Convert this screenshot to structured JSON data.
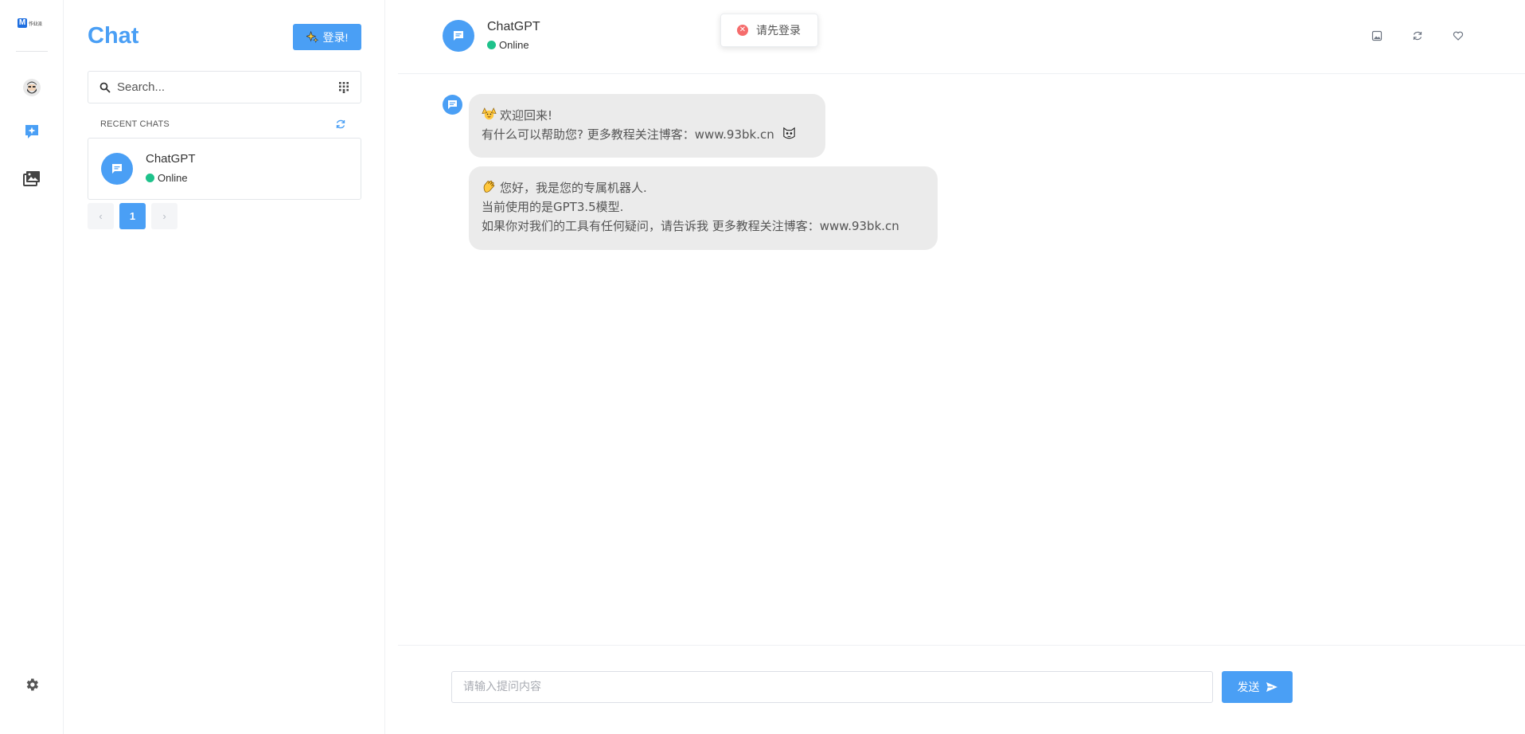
{
  "rail": {
    "logo_text": "作业派",
    "items": [
      {
        "name": "user-avatar",
        "icon": "bearded-man-avatar"
      },
      {
        "name": "chat",
        "icon": "chat-sparkle-icon"
      },
      {
        "name": "gallery",
        "icon": "images-icon"
      },
      {
        "name": "settings",
        "icon": "gear-icon"
      }
    ]
  },
  "panel": {
    "title": "Chat",
    "login_label": "登录!",
    "search_placeholder": "Search...",
    "recent_label": "RECENT CHATS",
    "chats": [
      {
        "name": "ChatGPT",
        "status": "Online"
      }
    ],
    "pager": {
      "current": "1",
      "prev": "‹",
      "next": "›"
    }
  },
  "header": {
    "name": "ChatGPT",
    "status": "Online"
  },
  "toast": {
    "text": "请先登录",
    "icon": "error-circle-icon"
  },
  "messages": [
    {
      "lines": [
        "欢迎回来!",
        "有什么可以帮助您? 更多教程关注博客：www.93bk.cn"
      ]
    },
    {
      "lines": [
        "您好，我是您的专属机器人.",
        "当前使用的是GPT3.5模型.",
        "如果你对我们的工具有任何疑问，请告诉我 更多教程关注博客：www.93bk.cn"
      ]
    }
  ],
  "composer": {
    "placeholder": "请输入提问内容",
    "send_label": "发送"
  },
  "colors": {
    "accent": "#4a9ff5",
    "online": "#1ec28b",
    "bubble": "#ebebeb",
    "error": "#f56c6c"
  }
}
